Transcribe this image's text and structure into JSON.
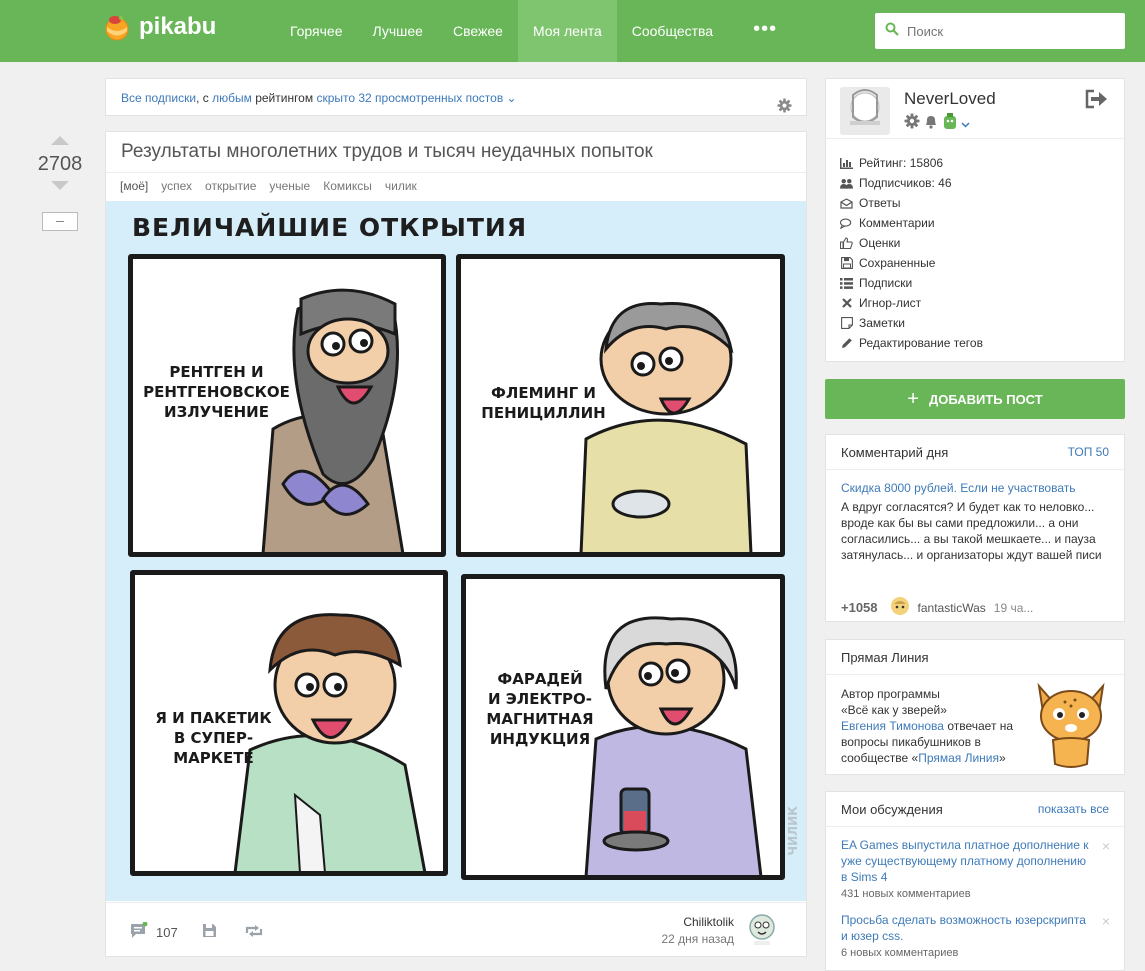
{
  "header": {
    "logo_text": "pikabu",
    "nav": [
      "Горячее",
      "Лучшее",
      "Свежее",
      "Моя лента",
      "Сообщества"
    ],
    "nav_active": "Моя лента",
    "more_label": "•••",
    "search_placeholder": "Поиск",
    "brand_color": "#68b657"
  },
  "filter": {
    "all_subs": "Все подписки",
    "sep": ", с",
    "any": "любым",
    "rating": "рейтингом",
    "hidden": "скрыто 32 просмотренных постов",
    "chevron": "⌄"
  },
  "post": {
    "rating": "2708",
    "title": "Результаты многолетних трудов и тысяч неудачных попыток",
    "tags": [
      "[моё]",
      "успех",
      "открытие",
      "ученые",
      "Комиксы",
      "чилик"
    ],
    "comic": {
      "title": "ВЕЛИЧАЙШИЕ ОТКРЫТИЯ",
      "panels": [
        {
          "caption": [
            "РЕНТГЕН И",
            "РЕНТГЕНОВСКОЕ",
            "ИЗЛУЧЕНИЕ"
          ]
        },
        {
          "caption": [
            "ФЛЕМИНГ И",
            "ПЕНИЦИЛЛИН"
          ]
        },
        {
          "caption": [
            "Я И ПАКЕТИК",
            "В СУПЕР-",
            "МАРКЕТЕ"
          ]
        },
        {
          "caption": [
            "ФАРАДЕЙ",
            "И ЭЛЕКТРО-",
            "МАГНИТНАЯ",
            "ИНДУКЦИЯ"
          ]
        }
      ],
      "watermark": "ЧИЛИК"
    },
    "comments_count": "107",
    "author": "Chiliktolik",
    "time": "22 дня назад"
  },
  "profile": {
    "username": "NeverLoved",
    "items": [
      {
        "icon": "bar-chart-icon",
        "label": "Рейтинг: 15806"
      },
      {
        "icon": "users-icon",
        "label": "Подписчиков: 46"
      },
      {
        "icon": "envelope-icon",
        "label": "Ответы"
      },
      {
        "icon": "comments-icon",
        "label": "Комментарии"
      },
      {
        "icon": "thumbs-up-icon",
        "label": "Оценки"
      },
      {
        "icon": "floppy-icon",
        "label": "Сохраненные"
      },
      {
        "icon": "list-icon",
        "label": "Подписки"
      },
      {
        "icon": "x-icon",
        "label": "Игнор-лист"
      },
      {
        "icon": "note-icon",
        "label": "Заметки"
      },
      {
        "icon": "pencil-icon",
        "label": "Редактирование тегов"
      }
    ]
  },
  "add_post": {
    "plus": "+",
    "label": "ДОБАВИТЬ ПОСТ"
  },
  "comment_of_day": {
    "heading": "Комментарий дня",
    "top_link": "ТОП 50",
    "post_title": "Скидка 8000 рублей. Если не участвовать",
    "text": "А вдруг согласятся? И будет как то неловко... вроде как бы вы сами предложили... а они согласились... а вы такой мешкаете... и пауза затянулась... и организаторы ждут вашей писи",
    "rating": "+1058",
    "user": "fantasticWas",
    "time": "19 ча..."
  },
  "direct_line": {
    "heading": "Прямая Линия",
    "line1": "Автор программы",
    "line2": "«Всё как у зверей»",
    "person": "Евгения Тимонова",
    "line3": " отвечает на вопросы пикабушников в сообществе «",
    "community": "Прямая Линия",
    "end": "»"
  },
  "discussions": {
    "heading": "Мои обсуждения",
    "show_all": "показать все",
    "close": "×",
    "items": [
      {
        "title": "EA Games выпустила платное дополнение к уже существующему платному дополнению в Sims 4",
        "sub": "431 новых комментариев"
      },
      {
        "title": "Просьба сделать возможность юзерскрипта и юзер css.",
        "sub": "6 новых комментариев"
      }
    ]
  }
}
